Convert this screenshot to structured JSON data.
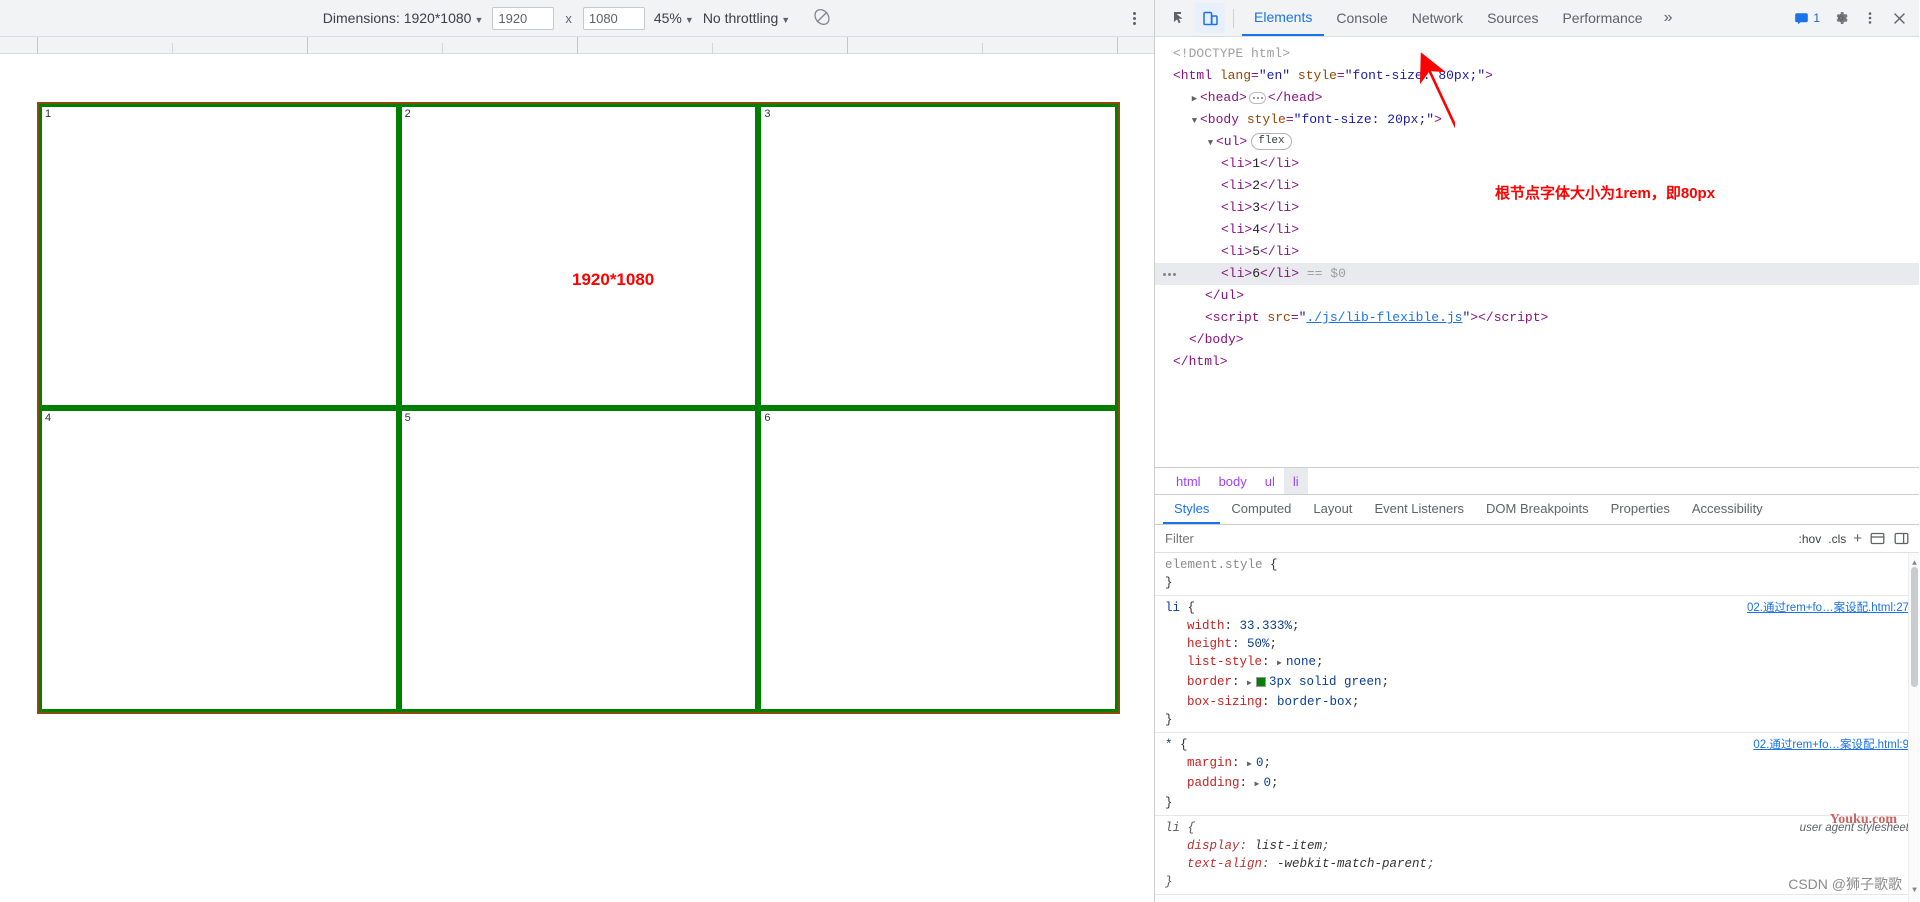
{
  "device_toolbar": {
    "dimensions_label": "Dimensions: 1920*1080",
    "width_value": "1920",
    "height_value": "1080",
    "separator": "x",
    "zoom_value": "45%",
    "throttling_value": "No throttling",
    "rotate_icon": "rotate-icon",
    "more_options_icon": "kebab-menu-icon",
    "caret": "▼"
  },
  "viewport": {
    "annotation_text": "1920*1080",
    "cells": [
      {
        "number": "1"
      },
      {
        "number": "2"
      },
      {
        "number": "3"
      },
      {
        "number": "4"
      },
      {
        "number": "5"
      },
      {
        "number": "6"
      }
    ],
    "frame_border_color": "#8a4b0d",
    "cell_border_color": "#008000",
    "annotation_color": "#ff0000"
  },
  "devtools": {
    "inspect_icon": "inspect-element-icon",
    "device_toggle_icon": "device-toolbar-icon",
    "tabs": [
      {
        "label": "Elements",
        "selected": true
      },
      {
        "label": "Console",
        "selected": false
      },
      {
        "label": "Network",
        "selected": false
      },
      {
        "label": "Sources",
        "selected": false
      },
      {
        "label": "Performance",
        "selected": false
      }
    ],
    "more_tabs_icon": "»",
    "issues_icon": "issues-message-icon",
    "issues_count": "1",
    "settings_icon": "gear-icon",
    "menu_icon": "vertical-kebab-icon",
    "close_icon": "close-icon",
    "annotation_text": "根节点字体大小为1rem，即80px",
    "annotation_color": "#ff0000"
  },
  "dom_tree": {
    "rows": [
      {
        "kind": "doctype",
        "text": "<!DOCTYPE html>",
        "indent": 0
      },
      {
        "kind": "open_attr",
        "tag": "html",
        "attr": "lang",
        "attrval": "\"en\"",
        "attr2": "style",
        "attrval2": "\"font-size: 80px;\"",
        "indent": 0
      },
      {
        "kind": "collapsed",
        "tag": "head",
        "indent": 1,
        "twisty": "▶"
      },
      {
        "kind": "open_style",
        "tag": "body",
        "attr": "style",
        "attrval": "\"font-size: 20px;\"",
        "indent": 1,
        "twisty": "▼"
      },
      {
        "kind": "ul_flex",
        "tag": "ul",
        "badge": "flex",
        "indent": 2,
        "twisty": "▼"
      },
      {
        "kind": "li",
        "text": "1",
        "indent": 3
      },
      {
        "kind": "li",
        "text": "2",
        "indent": 3
      },
      {
        "kind": "li",
        "text": "3",
        "indent": 3
      },
      {
        "kind": "li",
        "text": "4",
        "indent": 3
      },
      {
        "kind": "li",
        "text": "5",
        "indent": 3
      },
      {
        "kind": "li_selected",
        "text": "6",
        "indent": 3,
        "suffix": "== $0"
      },
      {
        "kind": "close",
        "tag": "ul",
        "indent": 2
      },
      {
        "kind": "script",
        "tag": "script",
        "attr": "src",
        "link": "./js/lib-flexible.js",
        "indent": 2
      },
      {
        "kind": "close",
        "tag": "body",
        "indent": 1
      },
      {
        "kind": "close",
        "tag": "html",
        "indent": 0
      }
    ]
  },
  "breadcrumb": {
    "items": [
      {
        "label": "html",
        "selected": false
      },
      {
        "label": "body",
        "selected": false
      },
      {
        "label": "ul",
        "selected": false
      },
      {
        "label": "li",
        "selected": true
      }
    ]
  },
  "styles_panel": {
    "tabs": [
      {
        "label": "Styles",
        "selected": true
      },
      {
        "label": "Computed",
        "selected": false
      },
      {
        "label": "Layout",
        "selected": false
      },
      {
        "label": "Event Listeners",
        "selected": false
      },
      {
        "label": "DOM Breakpoints",
        "selected": false
      },
      {
        "label": "Properties",
        "selected": false
      },
      {
        "label": "Accessibility",
        "selected": false
      }
    ],
    "filter_placeholder": "Filter",
    "filter_value": "",
    "hov_label": ":hov",
    "cls_label": ".cls",
    "plus_label": "+",
    "new_style_rule_icon": "new-style-rule-icon",
    "toggle_sidebar_icon": "toggle-sidebar-icon",
    "rules": [
      {
        "selector": "element.style",
        "selector_gray": true,
        "source": "",
        "declarations": []
      },
      {
        "selector": "li",
        "selector_gray": false,
        "source": "02.通过rem+fo…案设配.html:27",
        "declarations": [
          {
            "prop": "width",
            "value": "33.333%"
          },
          {
            "prop": "height",
            "value": "50%"
          },
          {
            "prop": "list-style",
            "value": "none",
            "expandable": true
          },
          {
            "prop": "border",
            "value": "3px solid green",
            "expandable": true,
            "swatch": "#008000"
          },
          {
            "prop": "box-sizing",
            "value": "border-box"
          }
        ]
      },
      {
        "selector": "*",
        "selector_gray": false,
        "source": "02.通过rem+fo…案设配.html:9",
        "declarations": [
          {
            "prop": "margin",
            "value": "0",
            "expandable": true
          },
          {
            "prop": "padding",
            "value": "0",
            "expandable": true
          }
        ]
      },
      {
        "selector": "li",
        "selector_gray": false,
        "ua": true,
        "source_label": "user agent stylesheet",
        "declarations": [
          {
            "prop": "display",
            "value": "list-item"
          },
          {
            "prop": "text-align",
            "value": "-webkit-match-parent"
          }
        ]
      }
    ]
  },
  "watermarks": {
    "csdn": "CSDN @狮子歌歌",
    "youku": "Youku.com"
  }
}
